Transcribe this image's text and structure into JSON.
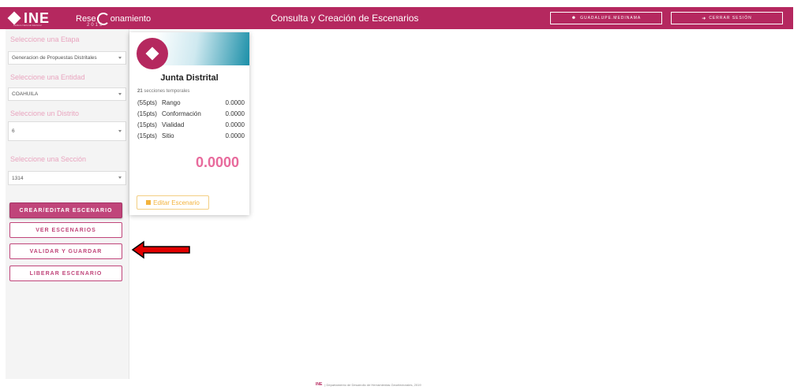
{
  "header": {
    "logo_text": "INE",
    "logo_subtext": "Instituto Nacional Electoral",
    "brand_prefix": "Rese",
    "brand_suffix": "onamiento",
    "brand_year": "2019",
    "title": "Consulta y Creación de Escenarios",
    "user_button": "GUADALUPE.MEDINAMA",
    "logout_button": "CERRAR SESIÓN",
    "brand_color": "#b5285f"
  },
  "sidebar": {
    "etapa_label": "Seleccione una Etapa",
    "etapa_value": "Generacion de Propuestas Distritales",
    "entidad_label": "Seleccione una Entidad",
    "entidad_value": "COAHUILA",
    "distrito_label": "Seleccione un Distrito",
    "distrito_value": "6",
    "seccion_label": "Seleccione una Sección",
    "seccion_value": "1314",
    "buttons": {
      "crear": "CREAR/EDITAR ESCENARIO",
      "ver": "VER ESCENARIOS",
      "validar": "VALIDAR Y GUARDAR",
      "liberar": "LIBERAR ESCENARIO"
    }
  },
  "card": {
    "title": "Junta Distrital",
    "subtitle_count": "21",
    "subtitle_text": "secciones temporales",
    "scores": [
      {
        "pts": "(55pts)",
        "name": "Rango",
        "value": "0.0000"
      },
      {
        "pts": "(15pts)",
        "name": "Conformación",
        "value": "0.0000"
      },
      {
        "pts": "(15pts)",
        "name": "Vialidad",
        "value": "0.0000"
      },
      {
        "pts": "(15pts)",
        "name": "Sitio",
        "value": "0.0000"
      }
    ],
    "total": "0.0000",
    "edit_button": "Editar Escenario",
    "accent_color": "#e86a9c"
  },
  "footer": {
    "logo": "INE",
    "text": "| Departamento de Desarrollo de Herramientas Geoelectorales, 2019"
  }
}
